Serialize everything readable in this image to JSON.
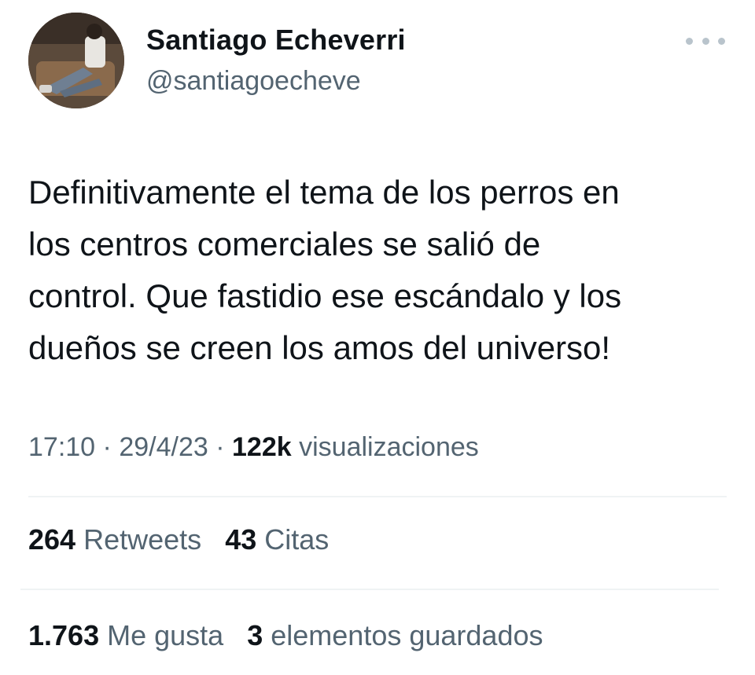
{
  "author": {
    "display_name": "Santiago Echeverri",
    "handle": "@santiagoecheve",
    "avatar": "user-avatar-photo"
  },
  "more_icon": "more-options-icon",
  "tweet": {
    "text": "Definitivamente el tema de los perros en\nlos centros comerciales se salió de\ncontrol. Que fastidio ese escándalo y los\ndueños se creen los amos del universo!",
    "time": "17:10",
    "date": "29/4/23",
    "separator": "·",
    "views_count": "122k",
    "views_label": "visualizaciones"
  },
  "stats": {
    "retweets_count": "264",
    "retweets_label": "Retweets",
    "quotes_count": "43",
    "quotes_label": "Citas",
    "likes_count": "1.763",
    "likes_label": "Me gusta",
    "bookmarks_count": "3",
    "bookmarks_label": "elementos guardados"
  },
  "colors": {
    "text_primary": "#0f1419",
    "text_secondary": "#536471",
    "divider": "#eff3f4"
  }
}
